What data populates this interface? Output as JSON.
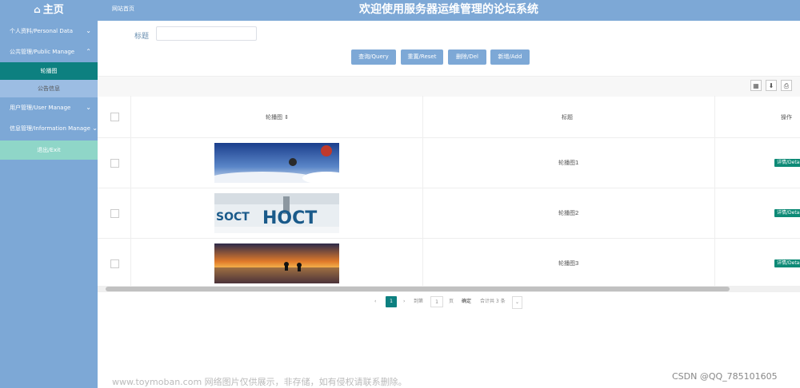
{
  "sidebar": {
    "logo": "主页",
    "items": [
      {
        "label": "个人资料/Personal Data"
      },
      {
        "label": "公共管理/Public Manage"
      },
      {
        "label": "用户管理/User Manage"
      },
      {
        "label": "信息管理/Information Manage"
      }
    ],
    "sub_items": [
      {
        "label": "轮播图"
      },
      {
        "label": "公告信息"
      }
    ],
    "exit": "退出/Exit"
  },
  "header": {
    "breadcrumb": "网站首页",
    "title": "欢迎使用服务器运维管理的论坛系统"
  },
  "search": {
    "label": "标题",
    "value": "",
    "buttons": [
      "查询/Query",
      "重置/Reset",
      "删除/Del",
      "新增/Add"
    ]
  },
  "table": {
    "columns": [
      "轮播图",
      "标题",
      "操作"
    ],
    "rows": [
      {
        "title": "轮播图1",
        "action": "详情/Details"
      },
      {
        "title": "轮播图2",
        "action": "详情/Details"
      },
      {
        "title": "轮播图3",
        "action": "详情/Details"
      }
    ]
  },
  "pagination": {
    "current": "1",
    "goto_label": "到第",
    "goto_value": "1",
    "page_unit": "页",
    "confirm": "确定",
    "total": "合计共 3 条"
  },
  "watermark": {
    "left": "www.toymoban.com 网络图片仅供展示，非存储，如有侵权请联系删除。",
    "right": "CSDN @QQ_785101605"
  }
}
